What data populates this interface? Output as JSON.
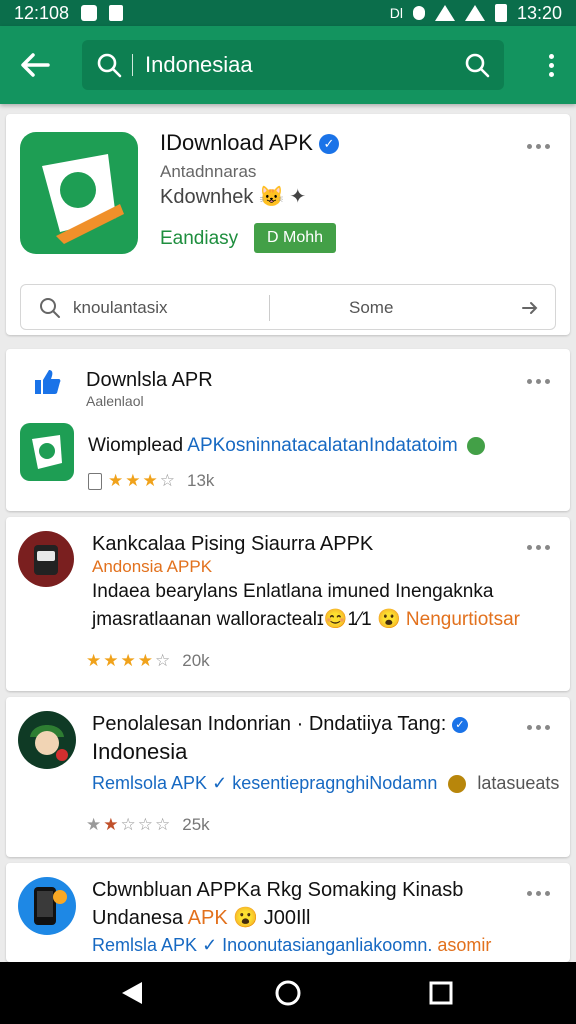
{
  "status": {
    "time_left": "12:108",
    "time_right": "13:20",
    "mid_text": "Dl"
  },
  "search": {
    "query": "Indonesiaa"
  },
  "featured": {
    "title": "IDownload APK",
    "line1": "Antadnnaras",
    "line2": "Kdownhek",
    "line2_emoji": "😺 ✦",
    "tag": "Eandiasy",
    "button_label": "D Mohh",
    "searchbar_text": "knoulantasix",
    "searchbar_right": "Some"
  },
  "cards": [
    {
      "title": "Downlsla APR",
      "subtitle": "Aalenlaol",
      "desc": "Wiomplead ",
      "desc_link": "APKosninnatacalatanIndatatoim",
      "rating_count": "13k",
      "rating": 3
    },
    {
      "title": "Kankcalaa Pising Siaurra APPK",
      "subtitle": "Andonsia APPK",
      "desc1": "Indaea bearylans Enlatlana imuned Inengaknka",
      "desc2": "jmasratlaanan walloractealɪ",
      "desc2_emoji": "😊1⁄1 😮",
      "desc2_orange": "Nengurtiotsar",
      "rating_count": "20k",
      "rating": 4
    },
    {
      "title": "Penolalesan Indonrian · Dndatiiya Tang:",
      "title2": "Indonesia",
      "link": "Remlsola APK",
      "link2": "kesentiepragnghiNodamn",
      "tail": "latasueats",
      "rating_count": "25k",
      "rating": 2
    },
    {
      "title": "Cbwnbluan APPKa Rkg Somaking Kinasb",
      "title2": "Undanesa",
      "title2_orange": "APK",
      "title2_tail": "😮 J00Ill",
      "link": "Remlsla APK",
      "link2": "Inoonutasianganliakoomn.",
      "tail": "asomir"
    }
  ],
  "colors": {
    "appbar": "#13945f",
    "statusbar": "#0b6e4b",
    "accent_green": "#1e8e3e",
    "star": "#f0a21b",
    "link_blue": "#1769c2"
  }
}
